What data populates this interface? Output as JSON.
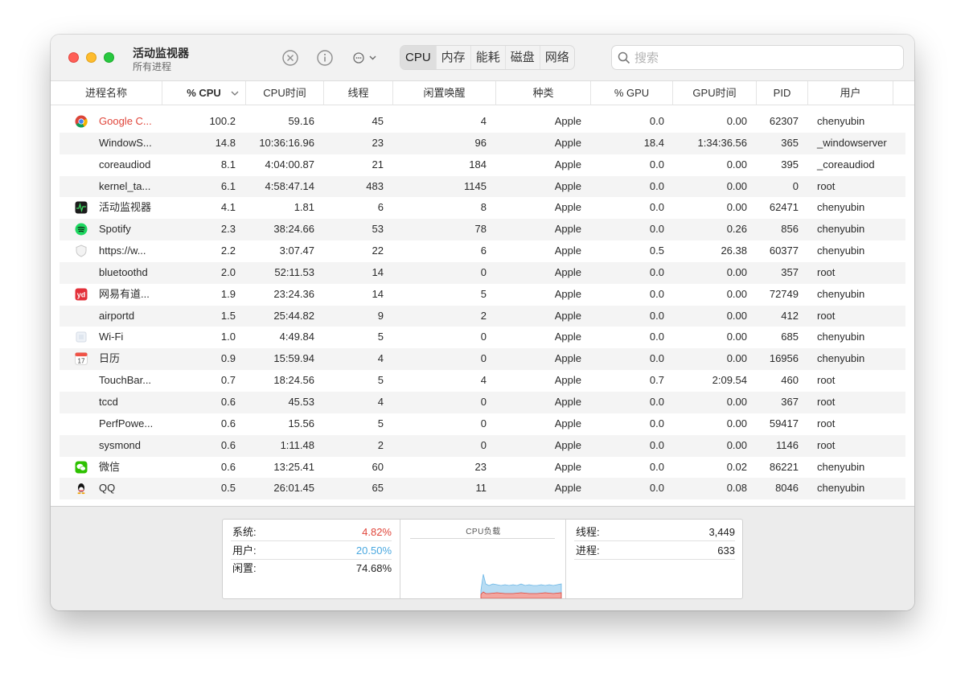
{
  "window": {
    "title": "活动监视器",
    "subtitle": "所有进程"
  },
  "toolbar": {
    "stop_icon": "x-circle-icon",
    "info_icon": "info-circle-icon",
    "more_icon": "ellipsis-circle-icon",
    "tabs": [
      "CPU",
      "内存",
      "能耗",
      "磁盘",
      "网络"
    ],
    "active_tab": "CPU",
    "search_placeholder": "搜索"
  },
  "columns": [
    "进程名称",
    "% CPU",
    "CPU时间",
    "线程",
    "闲置唤醒",
    "种类",
    "% GPU",
    "GPU时间",
    "PID",
    "用户"
  ],
  "sorted_column": "% CPU",
  "processes": [
    {
      "icon": "chrome-icon",
      "name": "Google C...",
      "cpu": "100.2",
      "cpu_time": "59.16",
      "threads": "45",
      "idle_wakeups": "4",
      "kind": "Apple",
      "gpu": "0.0",
      "gpu_time": "0.00",
      "pid": "62307",
      "user": "chenyubin",
      "highlight": true
    },
    {
      "icon": "",
      "name": "WindowS...",
      "cpu": "14.8",
      "cpu_time": "10:36:16.96",
      "threads": "23",
      "idle_wakeups": "96",
      "kind": "Apple",
      "gpu": "18.4",
      "gpu_time": "1:34:36.56",
      "pid": "365",
      "user": "_windowserver"
    },
    {
      "icon": "",
      "name": "coreaudiod",
      "cpu": "8.1",
      "cpu_time": "4:04:00.87",
      "threads": "21",
      "idle_wakeups": "184",
      "kind": "Apple",
      "gpu": "0.0",
      "gpu_time": "0.00",
      "pid": "395",
      "user": "_coreaudiod"
    },
    {
      "icon": "",
      "name": "kernel_ta...",
      "cpu": "6.1",
      "cpu_time": "4:58:47.14",
      "threads": "483",
      "idle_wakeups": "1145",
      "kind": "Apple",
      "gpu": "0.0",
      "gpu_time": "0.00",
      "pid": "0",
      "user": "root"
    },
    {
      "icon": "activity-monitor-icon",
      "name": "活动监视器",
      "cpu": "4.1",
      "cpu_time": "1.81",
      "threads": "6",
      "idle_wakeups": "8",
      "kind": "Apple",
      "gpu": "0.0",
      "gpu_time": "0.00",
      "pid": "62471",
      "user": "chenyubin"
    },
    {
      "icon": "spotify-icon",
      "name": "Spotify",
      "cpu": "2.3",
      "cpu_time": "38:24.66",
      "threads": "53",
      "idle_wakeups": "78",
      "kind": "Apple",
      "gpu": "0.0",
      "gpu_time": "0.26",
      "pid": "856",
      "user": "chenyubin"
    },
    {
      "icon": "shield-icon",
      "name": "https://w...",
      "cpu": "2.2",
      "cpu_time": "3:07.47",
      "threads": "22",
      "idle_wakeups": "6",
      "kind": "Apple",
      "gpu": "0.5",
      "gpu_time": "26.38",
      "pid": "60377",
      "user": "chenyubin"
    },
    {
      "icon": "",
      "name": "bluetoothd",
      "cpu": "2.0",
      "cpu_time": "52:11.53",
      "threads": "14",
      "idle_wakeups": "0",
      "kind": "Apple",
      "gpu": "0.0",
      "gpu_time": "0.00",
      "pid": "357",
      "user": "root"
    },
    {
      "icon": "youdao-icon",
      "name": "网易有道...",
      "cpu": "1.9",
      "cpu_time": "23:24.36",
      "threads": "14",
      "idle_wakeups": "5",
      "kind": "Apple",
      "gpu": "0.0",
      "gpu_time": "0.00",
      "pid": "72749",
      "user": "chenyubin"
    },
    {
      "icon": "",
      "name": "airportd",
      "cpu": "1.5",
      "cpu_time": "25:44.82",
      "threads": "9",
      "idle_wakeups": "2",
      "kind": "Apple",
      "gpu": "0.0",
      "gpu_time": "0.00",
      "pid": "412",
      "user": "root"
    },
    {
      "icon": "wifi-app-icon",
      "name": "Wi-Fi",
      "cpu": "1.0",
      "cpu_time": "4:49.84",
      "threads": "5",
      "idle_wakeups": "0",
      "kind": "Apple",
      "gpu": "0.0",
      "gpu_time": "0.00",
      "pid": "685",
      "user": "chenyubin"
    },
    {
      "icon": "calendar-icon",
      "name": "日历",
      "cpu": "0.9",
      "cpu_time": "15:59.94",
      "threads": "4",
      "idle_wakeups": "0",
      "kind": "Apple",
      "gpu": "0.0",
      "gpu_time": "0.00",
      "pid": "16956",
      "user": "chenyubin",
      "calendar_day": "17"
    },
    {
      "icon": "",
      "name": "TouchBar...",
      "cpu": "0.7",
      "cpu_time": "18:24.56",
      "threads": "5",
      "idle_wakeups": "4",
      "kind": "Apple",
      "gpu": "0.7",
      "gpu_time": "2:09.54",
      "pid": "460",
      "user": "root"
    },
    {
      "icon": "",
      "name": "tccd",
      "cpu": "0.6",
      "cpu_time": "45.53",
      "threads": "4",
      "idle_wakeups": "0",
      "kind": "Apple",
      "gpu": "0.0",
      "gpu_time": "0.00",
      "pid": "367",
      "user": "root"
    },
    {
      "icon": "",
      "name": "PerfPowe...",
      "cpu": "0.6",
      "cpu_time": "15.56",
      "threads": "5",
      "idle_wakeups": "0",
      "kind": "Apple",
      "gpu": "0.0",
      "gpu_time": "0.00",
      "pid": "59417",
      "user": "root"
    },
    {
      "icon": "",
      "name": "sysmond",
      "cpu": "0.6",
      "cpu_time": "1:11.48",
      "threads": "2",
      "idle_wakeups": "0",
      "kind": "Apple",
      "gpu": "0.0",
      "gpu_time": "0.00",
      "pid": "1146",
      "user": "root"
    },
    {
      "icon": "wechat-icon",
      "name": "微信",
      "cpu": "0.6",
      "cpu_time": "13:25.41",
      "threads": "60",
      "idle_wakeups": "23",
      "kind": "Apple",
      "gpu": "0.0",
      "gpu_time": "0.02",
      "pid": "86221",
      "user": "chenyubin"
    },
    {
      "icon": "qq-icon",
      "name": "QQ",
      "cpu": "0.5",
      "cpu_time": "26:01.45",
      "threads": "65",
      "idle_wakeups": "11",
      "kind": "Apple",
      "gpu": "0.0",
      "gpu_time": "0.08",
      "pid": "8046",
      "user": "chenyubin"
    }
  ],
  "summary": {
    "system_label": "系统:",
    "system_value": "4.82%",
    "user_label": "用户:",
    "user_value": "20.50%",
    "idle_label": "闲置:",
    "idle_value": "74.68%",
    "threads_label": "线程:",
    "threads_value": "3,449",
    "processes_label": "进程:",
    "processes_value": "633",
    "chart_title": "CPU负载"
  },
  "colors": {
    "system": "#e0453a",
    "user": "#4aa8e0",
    "highlight_text": "#e0453a"
  }
}
